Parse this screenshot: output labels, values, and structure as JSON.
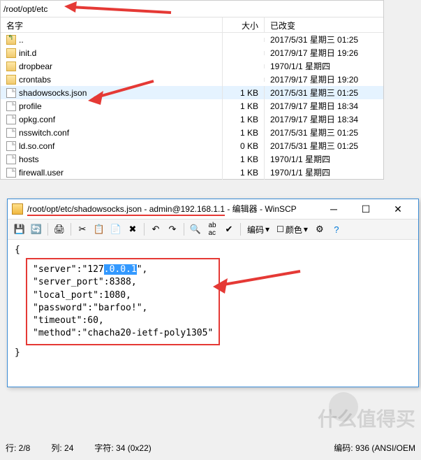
{
  "browser": {
    "path": "/root/opt/etc",
    "headers": {
      "name": "名字",
      "size": "大小",
      "changed": "已改变"
    },
    "rows": [
      {
        "icon": "up",
        "name": "..",
        "size": "",
        "date": "2017/5/31 星期三 01:25",
        "sel": false
      },
      {
        "icon": "folder",
        "name": "init.d",
        "size": "",
        "date": "2017/9/17 星期日 19:26",
        "sel": false
      },
      {
        "icon": "folder",
        "name": "dropbear",
        "size": "",
        "date": "1970/1/1 星期四",
        "sel": false
      },
      {
        "icon": "folder",
        "name": "crontabs",
        "size": "",
        "date": "2017/9/17 星期日 19:20",
        "sel": false
      },
      {
        "icon": "file",
        "name": "shadowsocks.json",
        "size": "1 KB",
        "date": "2017/5/31 星期三 01:25",
        "sel": true
      },
      {
        "icon": "file",
        "name": "profile",
        "size": "1 KB",
        "date": "2017/9/17 星期日 18:34",
        "sel": false
      },
      {
        "icon": "file",
        "name": "opkg.conf",
        "size": "1 KB",
        "date": "2017/9/17 星期日 18:34",
        "sel": false
      },
      {
        "icon": "file",
        "name": "nsswitch.conf",
        "size": "1 KB",
        "date": "2017/5/31 星期三 01:25",
        "sel": false
      },
      {
        "icon": "file",
        "name": "ld.so.conf",
        "size": "0 KB",
        "date": "2017/5/31 星期三 01:25",
        "sel": false
      },
      {
        "icon": "file",
        "name": "hosts",
        "size": "1 KB",
        "date": "1970/1/1 星期四",
        "sel": false
      },
      {
        "icon": "file",
        "name": "firewall.user",
        "size": "1 KB",
        "date": "1970/1/1 星期四",
        "sel": false
      }
    ]
  },
  "editor": {
    "title_path": "/root/opt/etc/shadowsocks.json",
    "title_user": " - admin@192.168.1.1",
    "title_suffix": " - 编辑器 - WinSCP",
    "encoding_label": "编码",
    "color_label": "颜色",
    "content": {
      "open": "{",
      "l1a": "\"server\":\"127",
      "l1sel": ".0.0.1",
      "l1b": "\",",
      "l2": "\"server_port\":8388,",
      "l3": "\"local_port\":1080,",
      "l4": "\"password\":\"barfoo!\",",
      "l5": "\"timeout\":60,",
      "l6": "\"method\":\"chacha20-ietf-poly1305\"",
      "close": "}"
    }
  },
  "status": {
    "line": "行: 2/8",
    "col": "列: 24",
    "char": "字符: 34 (0x22)",
    "enc": "编码: 936 (ANSI/OEM"
  },
  "watermark": "什么值得买"
}
